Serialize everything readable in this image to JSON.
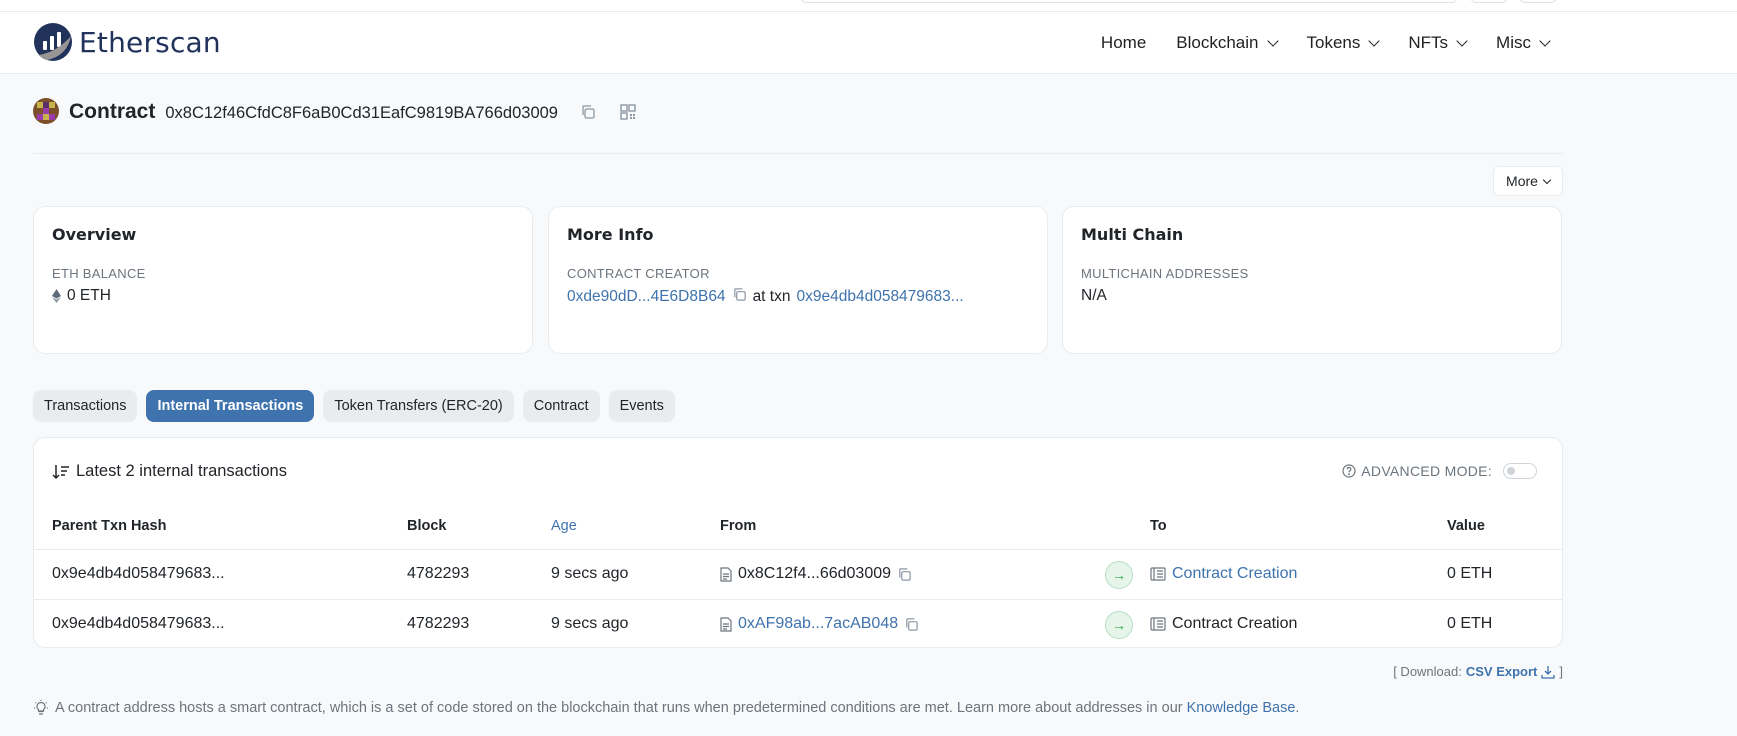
{
  "header": {
    "brand": "Etherscan",
    "nav": [
      "Home",
      "Blockchain",
      "Tokens",
      "NFTs",
      "Misc"
    ]
  },
  "title": {
    "label": "Contract",
    "address": "0x8C12f46CfdC8F6aB0Cd31EafC9819BA766d03009"
  },
  "more_button": "More",
  "overview": {
    "title": "Overview",
    "balance_label": "ETH BALANCE",
    "balance_value": "0 ETH"
  },
  "more_info": {
    "title": "More Info",
    "creator_label": "CONTRACT CREATOR",
    "creator_address": "0xde90dD...4E6D8B64",
    "at_txn": "at txn",
    "txn_hash": "0x9e4db4d058479683..."
  },
  "multi_chain": {
    "title": "Multi Chain",
    "label": "MULTICHAIN ADDRESSES",
    "value": "N/A"
  },
  "tabs": [
    "Transactions",
    "Internal Transactions",
    "Token Transfers (ERC-20)",
    "Contract",
    "Events"
  ],
  "internal": {
    "heading": "Latest 2 internal transactions",
    "advanced_mode": "ADVANCED MODE:",
    "columns": [
      "Parent Txn Hash",
      "Block",
      "Age",
      "From",
      "To",
      "Value"
    ],
    "rows": [
      {
        "hash": "0x9e4db4d058479683...",
        "block": "4782293",
        "age": "9 secs ago",
        "from": "0x8C12f4...66d03009",
        "to": "Contract Creation",
        "value": "0 ETH"
      },
      {
        "hash": "0x9e4db4d058479683...",
        "block": "4782293",
        "age": "9 secs ago",
        "from": "0xAF98ab...7acAB048",
        "to": "Contract Creation",
        "value": "0 ETH"
      }
    ]
  },
  "download": {
    "prefix": "[ Download:",
    "link": "CSV Export",
    "suffix": "]"
  },
  "footnote": {
    "text": "A contract address hosts a smart contract, which is a set of code stored on the blockchain that runs when predetermined conditions are met. Learn more about addresses in our",
    "link": "Knowledge Base",
    "end": "."
  },
  "colors": {
    "accent": "#3f73ad",
    "brand": "#21325b",
    "tab_bg": "#e9ecef",
    "success": "#28a745"
  }
}
